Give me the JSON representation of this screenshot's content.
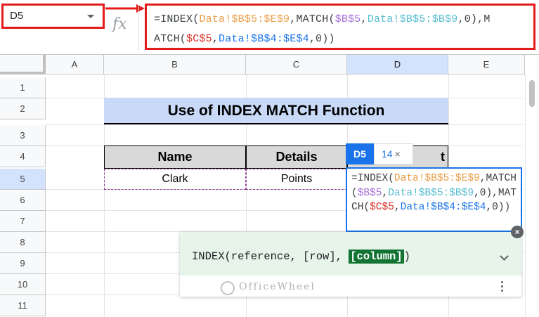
{
  "name_box": {
    "value": "D5"
  },
  "formula_bar": {
    "fx_label": "fx",
    "segments": [
      {
        "text": "=INDEX(",
        "color": "default"
      },
      {
        "text": "Data!$B$5:$E$9",
        "color": "orange"
      },
      {
        "text": ",MATCH(",
        "color": "default"
      },
      {
        "text": "$B$5",
        "color": "purple"
      },
      {
        "text": ",",
        "color": "default"
      },
      {
        "text": "Data!$B$5:$B$9",
        "color": "teal"
      },
      {
        "text": ",0),M",
        "color": "default"
      },
      {
        "text": "ATCH(",
        "color": "default"
      },
      {
        "text": "$C$5",
        "color": "red"
      },
      {
        "text": ",",
        "color": "default"
      },
      {
        "text": "Data!$B$4:$E$4",
        "color": "blue"
      },
      {
        "text": ",0))",
        "color": "default"
      }
    ]
  },
  "columns": [
    "A",
    "B",
    "C",
    "D",
    "E"
  ],
  "rows": [
    "1",
    "2",
    "3",
    "4",
    "5",
    "6",
    "7",
    "8",
    "9",
    "10",
    "11"
  ],
  "sheet": {
    "title": "Use of INDEX MATCH Function",
    "headers": [
      "Name",
      "Details",
      "t"
    ],
    "row5": [
      "Clark",
      "Points"
    ]
  },
  "cell_editor": {
    "cell_ref": "D5",
    "count_label": "14",
    "close_glyph": "×"
  },
  "function_help": {
    "prefix": "INDEX(reference, [row], ",
    "highlight": "[column]",
    "suffix": ")",
    "close_glyph": "×"
  },
  "watermark": "OfficeWheel",
  "colors": {
    "orange": "#e99e47",
    "purple": "#a56fd9",
    "teal": "#55bdd1",
    "blue": "#1a73e8",
    "red": "#d93025",
    "highlight_red": "#e31b1b",
    "title_fill": "#c9daf8",
    "help_bg": "#e6f4ea",
    "help_highlight": "#137333"
  }
}
